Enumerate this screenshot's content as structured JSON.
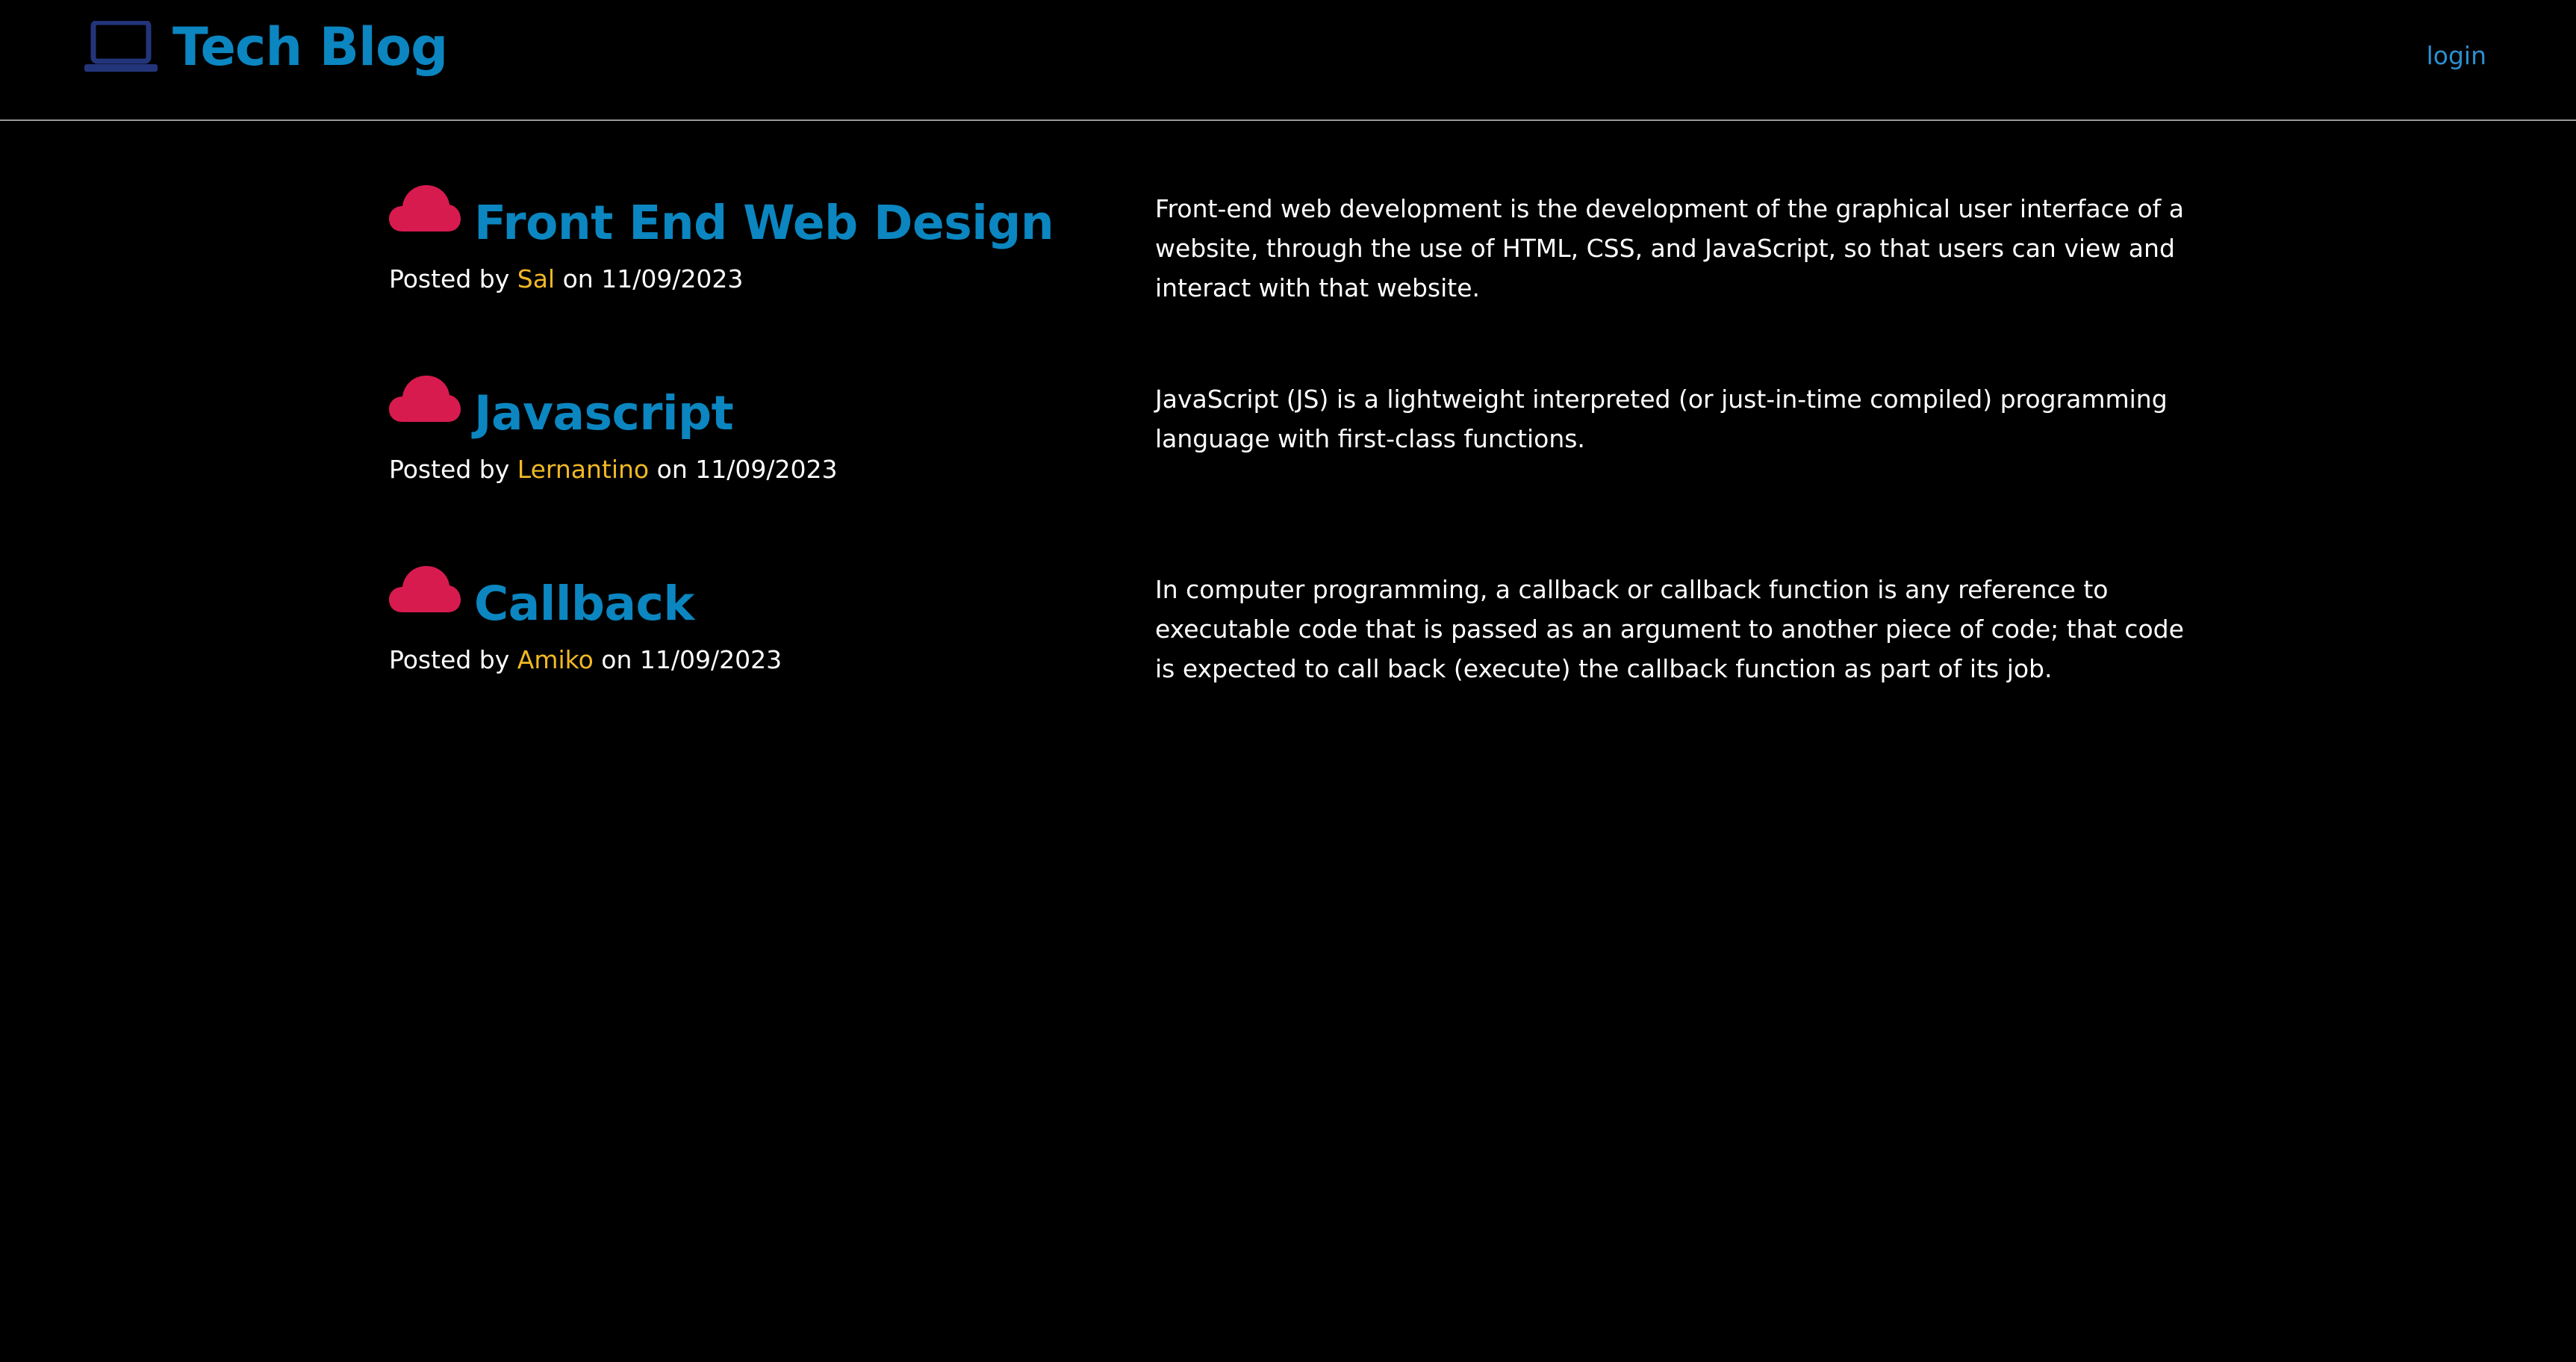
{
  "header": {
    "brand_title": "Tech Blog",
    "brand_icon": "laptop-icon",
    "login_label": "login"
  },
  "colors": {
    "background": "#000000",
    "brand": "#0b86c0",
    "author": "#f1b825",
    "cloud_icon": "#d81b4f",
    "laptop_icon": "#23357a",
    "login": "#2d8fd0"
  },
  "posts": [
    {
      "icon": "cloud-icon",
      "title": "Front End Web Design",
      "posted_by_prefix": "Posted by",
      "author": "Sal",
      "date_prefix": "on",
      "date": "11/09/2023",
      "body": "Front-end web development is the development of the graphical user interface of a website, through the use of HTML, CSS, and JavaScript, so that users can view and interact with that website."
    },
    {
      "icon": "cloud-icon",
      "title": "Javascript",
      "posted_by_prefix": "Posted by",
      "author": "Lernantino",
      "date_prefix": "on",
      "date": "11/09/2023",
      "body": "JavaScript (JS) is a lightweight interpreted (or just-in-time compiled) programming language with first-class functions."
    },
    {
      "icon": "cloud-icon",
      "title": "Callback",
      "posted_by_prefix": "Posted by",
      "author": "Amiko",
      "date_prefix": "on",
      "date": "11/09/2023",
      "body": "In computer programming, a callback or callback function is any reference to executable code that is passed as an argument to another piece of code; that code is expected to call back (execute) the callback function as part of its job."
    }
  ]
}
